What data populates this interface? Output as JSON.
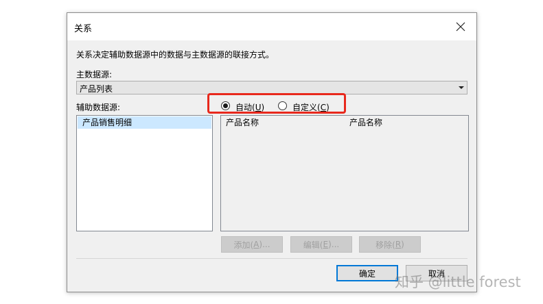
{
  "dialog": {
    "title": "关系",
    "description": "关系决定辅助数据源中的数据与主数据源的联接方式。"
  },
  "main_source": {
    "label": "主数据源:",
    "selected": "产品列表"
  },
  "secondary_source": {
    "label": "辅助数据源:",
    "items": [
      "产品销售明细"
    ]
  },
  "mode": {
    "auto_label": "自动(",
    "auto_key": "U",
    "custom_label": "自定义(",
    "custom_key": "C",
    "close_paren": ")",
    "selected": "auto"
  },
  "grid": {
    "col1": "产品名称",
    "col2": "产品名称"
  },
  "buttons": {
    "add_label": "添加(",
    "add_key": "A",
    "add_suffix": ")...",
    "edit_label": "编辑(",
    "edit_key": "E",
    "edit_suffix": ")...",
    "remove_label": "移除(",
    "remove_key": "R",
    "remove_suffix": ")",
    "ok": "确定",
    "cancel": "取消"
  },
  "watermark": "知乎 @little forest"
}
